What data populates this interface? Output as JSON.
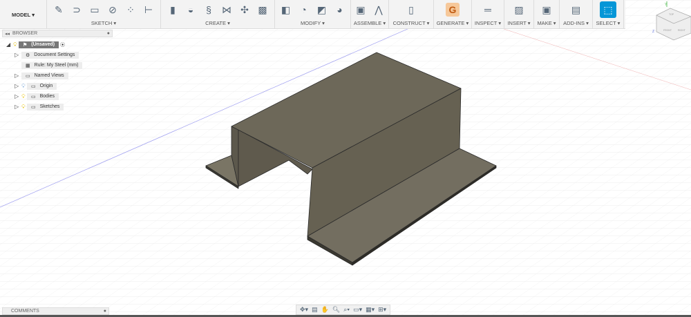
{
  "toolbar": {
    "workspace": "MODEL",
    "groups": [
      {
        "label": "SKETCH",
        "icons": [
          "sketch-icon",
          "line-icon",
          "rectangle-icon",
          "circle-icon",
          "pattern-icon",
          "dimension-icon"
        ]
      },
      {
        "label": "CREATE",
        "icons": [
          "extrude-icon",
          "revolve-icon",
          "sweep-icon",
          "loft-icon",
          "mirror-icon",
          "form-icon"
        ]
      },
      {
        "label": "MODIFY",
        "icons": [
          "press-pull-icon",
          "fillet-icon",
          "chamfer-icon",
          "appearance-icon"
        ]
      },
      {
        "label": "ASSEMBLE",
        "icons": [
          "new-component-icon",
          "joint-icon"
        ]
      },
      {
        "label": "CONSTRUCT",
        "icons": [
          "plane-icon"
        ]
      },
      {
        "label": "GENERATE",
        "icons": [
          "generative-icon"
        ]
      },
      {
        "label": "INSPECT",
        "icons": [
          "measure-icon"
        ]
      },
      {
        "label": "INSERT",
        "icons": [
          "insert-image-icon"
        ]
      },
      {
        "label": "MAKE",
        "icons": [
          "3d-print-icon"
        ]
      },
      {
        "label": "ADD-INS",
        "icons": [
          "scripts-icon"
        ]
      },
      {
        "label": "SELECT",
        "icons": [
          "select-icon"
        ]
      }
    ]
  },
  "browser": {
    "title": "BROWSER",
    "root": "(Unsaved)",
    "items": [
      {
        "label": "Document Settings",
        "icon": "gear-icon"
      },
      {
        "label": "Rule: My Steel (mm)",
        "icon": "sheet-metal-rule-icon"
      },
      {
        "label": "Named Views",
        "icon": "folder-icon"
      },
      {
        "label": "Origin",
        "icon": "folder-icon"
      },
      {
        "label": "Bodies",
        "icon": "folder-icon"
      },
      {
        "label": "Sketches",
        "icon": "folder-icon"
      }
    ]
  },
  "comments": {
    "title": "COMMENTS"
  },
  "viewcube": {
    "top": "TOP",
    "front": "FRONT",
    "right": "RIGHT",
    "axes": [
      "X",
      "Y",
      "Z"
    ]
  },
  "colors": {
    "select_accent": "#0696d7",
    "body": "#6b6658",
    "axis_x": "#e05050",
    "axis_y": "#60c060",
    "axis_z": "#6070e0"
  }
}
